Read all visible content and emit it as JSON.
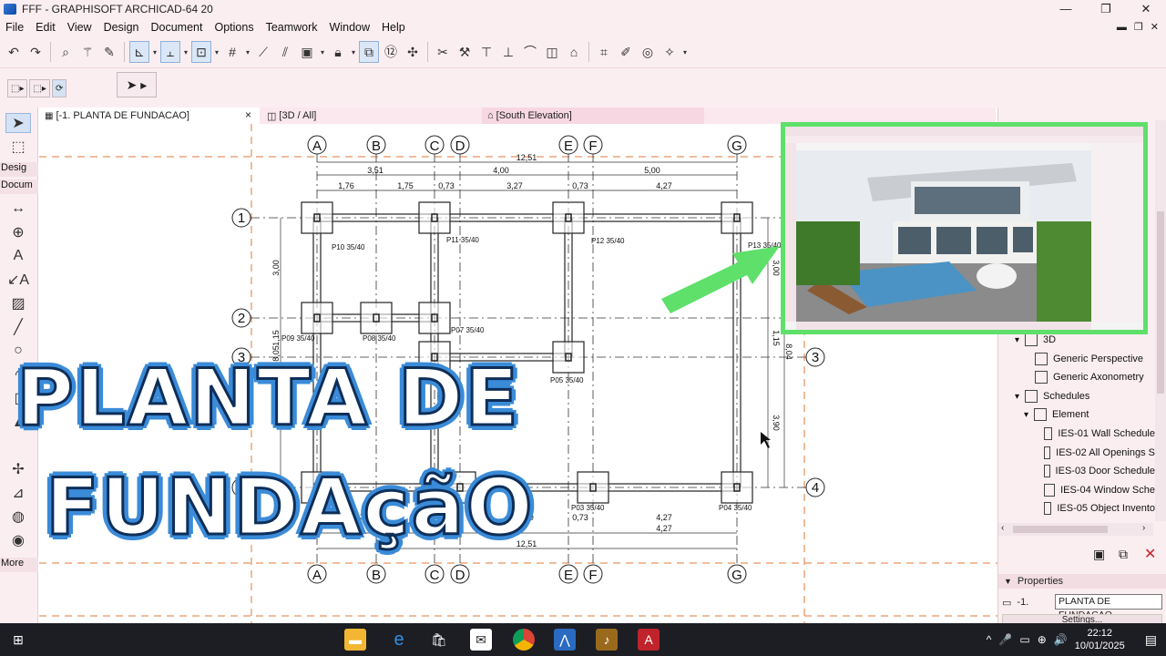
{
  "window": {
    "title": "FFF - GRAPHISOFT ARCHICAD-64 20",
    "minimize": "—",
    "maximize": "❐",
    "close": "✕"
  },
  "menu": {
    "items": [
      "File",
      "Edit",
      "View",
      "Design",
      "Document",
      "Options",
      "Teamwork",
      "Window",
      "Help"
    ],
    "ctrls": [
      "▬",
      "❐",
      "✕"
    ]
  },
  "toolbox": {
    "design_label": "Desig",
    "document_label": "Docum",
    "more_label": "More"
  },
  "tabs": [
    {
      "label": "[-1. PLANTA DE FUNDACAO]",
      "close": "×"
    },
    {
      "label": "[3D / All]"
    },
    {
      "label": "[South Elevation]"
    }
  ],
  "plan": {
    "axes_top": [
      "A",
      "B",
      "C",
      "D",
      "E",
      "F",
      "G"
    ],
    "axes_side": [
      "1",
      "2",
      "3",
      "4"
    ],
    "dims_top_total": "12,51",
    "dims_top_row1": [
      "3,51",
      "4,00",
      "5,00"
    ],
    "dims_top_row2": [
      "1,76",
      "1,75",
      "0,73",
      "3,27",
      "0,73",
      "4,27"
    ],
    "dims_bottom_row1": [
      "4,00",
      "0,73",
      "4,27"
    ],
    "dims_bottom_row2": [
      "4,27"
    ],
    "dims_bottom_total": "12,51",
    "dims_left": [
      "3,00",
      "1,15",
      "8,05"
    ],
    "dims_right": [
      "3,00",
      "1,15",
      "8,04",
      "3,90"
    ],
    "columns": [
      "P10",
      "P11",
      "P12",
      "P13",
      "P09",
      "P08",
      "P07",
      "P05",
      "P03",
      "P04",
      "P6"
    ],
    "column_size": "35/40"
  },
  "navigator": {
    "items": [
      {
        "label": "3D",
        "icon": "folder-icon",
        "expand": "▾"
      },
      {
        "label": "Generic Perspective",
        "icon": "camera-icon"
      },
      {
        "label": "Generic Axonometry",
        "icon": "cube-icon"
      },
      {
        "label": "Schedules",
        "icon": "table-icon",
        "expand": "▾"
      },
      {
        "label": "Element",
        "icon": "folder-icon",
        "expand": "▾"
      },
      {
        "label": "IES-01 Wall Schedule",
        "icon": "schedule-icon"
      },
      {
        "label": "IES-02 All Openings S",
        "icon": "schedule-icon"
      },
      {
        "label": "IES-03 Door Schedule",
        "icon": "schedule-icon"
      },
      {
        "label": "IES-04 Window Sche",
        "icon": "schedule-icon"
      },
      {
        "label": "IES-05 Object Invento",
        "icon": "schedule-icon"
      }
    ]
  },
  "properties": {
    "header": "Properties",
    "layer_id": "-1.",
    "value": "PLANTA DE FUNDACAO",
    "settings": "Settings..."
  },
  "overlay": {
    "line1": "PLANTA DE",
    "line2": "FUNDAçãO"
  },
  "taskbar": {
    "time": "22:12",
    "date": "10/01/2025",
    "tray_icons": [
      "^",
      "🎤",
      "▭",
      "⊕",
      "🔊"
    ]
  },
  "colors": {
    "accent_green": "#5ee06a",
    "overlay_fill": "#ffffff",
    "overlay_stroke": "#0e2e58",
    "overlay_glow": "#3a8bd8",
    "grid_dash": "#e07a3a",
    "ui_pink": "#fbeef1"
  }
}
